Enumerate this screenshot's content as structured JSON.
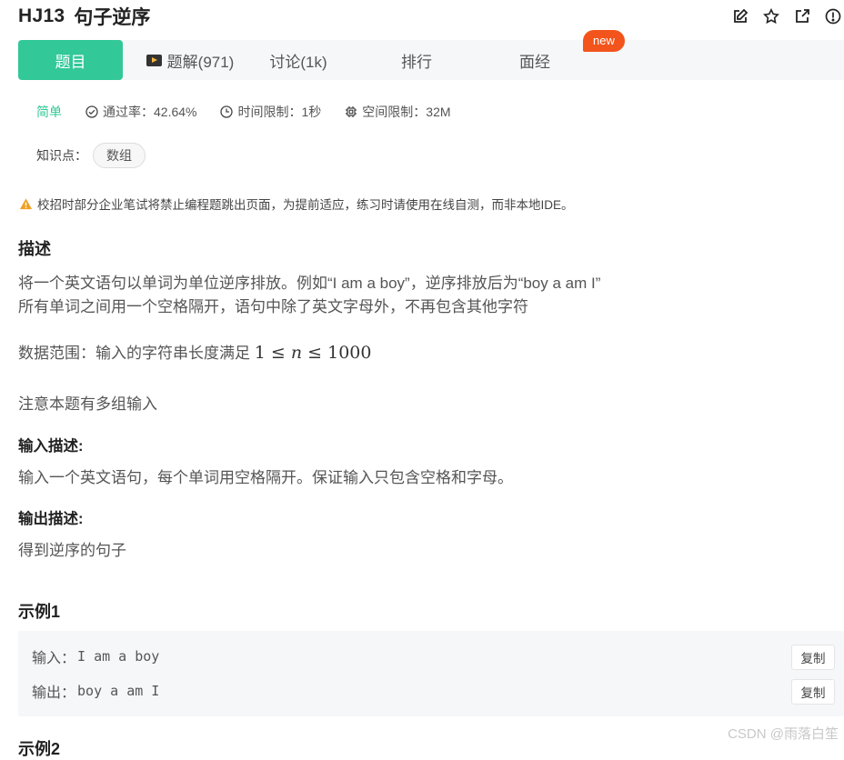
{
  "problem": {
    "id": "HJ13",
    "name": "句子逆序"
  },
  "tabs": [
    {
      "label": "题目"
    },
    {
      "label": "题解(971)"
    },
    {
      "label": "讨论(1k)"
    },
    {
      "label": "排行"
    },
    {
      "label": "面经"
    }
  ],
  "new_badge": "new",
  "meta": {
    "difficulty": "简单",
    "pass_rate": "通过率：42.64%",
    "time_limit": "时间限制：1秒",
    "space_limit": "空间限制：32M"
  },
  "knowledge": {
    "label": "知识点：",
    "tag": "数组"
  },
  "warning": "校招时部分企业笔试将禁止编程题跳出页面，为提前适应，练习时请使用在线自测，而非本地IDE。",
  "description": {
    "heading": "描述",
    "line1": "将一个英文语句以单词为单位逆序排放。例如“I am a boy”，逆序排放后为“boy a am I”",
    "line2": "所有单词之间用一个空格隔开，语句中除了英文字母外，不再包含其他字符",
    "range_prefix": "数据范围：输入的字符串长度满足",
    "range_math": {
      "low": "1",
      "var": "n",
      "high": "1000",
      "rel": "≤"
    },
    "note": "注意本题有多组输入"
  },
  "input_desc": {
    "heading": "输入描述:",
    "text": "输入一个英文语句，每个单词用空格隔开。保证输入只包含空格和字母。"
  },
  "output_desc": {
    "heading": "输出描述:",
    "text": "得到逆序的句子"
  },
  "example1": {
    "heading": "示例1",
    "input_label": "输入：",
    "input_value": "I am a boy",
    "output_label": "输出：",
    "output_value": "boy a am I",
    "copy_label": "复制"
  },
  "example2_heading": "示例2",
  "watermark": "CSDN @雨落白笙",
  "colors": {
    "accent": "#32c897",
    "badge": "#f2541c",
    "warning": "#f0a020"
  },
  "icons": [
    "edit-icon",
    "star-icon",
    "share-icon",
    "report-icon",
    "play-icon",
    "check-circle-icon",
    "clock-icon",
    "chip-icon",
    "warning-icon"
  ]
}
